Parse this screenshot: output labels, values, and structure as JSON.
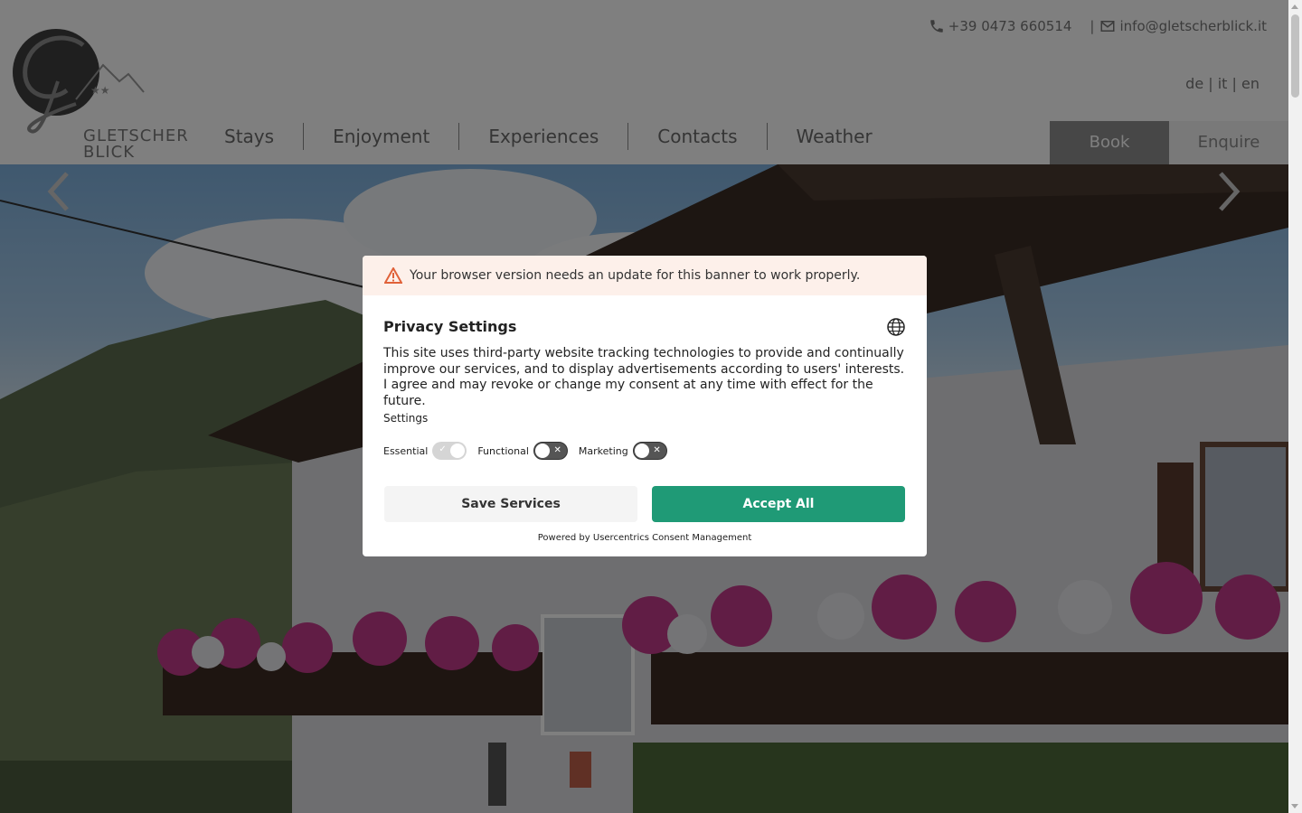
{
  "header": {
    "logo_text_line1": "GLETSCHER",
    "logo_text_line2": "BLICK",
    "phone": "+39 0473 660514",
    "separator": "|",
    "email": "info@gletscherblick.it",
    "languages": [
      "de",
      "it",
      "en"
    ],
    "lang_separator": " | ",
    "nav": [
      "Stays",
      "Enjoyment",
      "Experiences",
      "Contacts",
      "Weather"
    ],
    "book_label": "Book",
    "enquire_label": "Enquire"
  },
  "hero": {
    "prev_icon": "chevron-left-icon",
    "next_icon": "chevron-right-icon"
  },
  "consent": {
    "warning": "Your browser version needs an update for this banner to work properly.",
    "title": "Privacy Settings",
    "description": "This site uses third-party website tracking technologies to provide and continually improve our services, and to display advertisements according to users' interests. I agree and may revoke or change my consent at any time with effect for the future.",
    "settings_label": "Settings",
    "toggles": [
      {
        "label": "Essential",
        "state": "on"
      },
      {
        "label": "Functional",
        "state": "off"
      },
      {
        "label": "Marketing",
        "state": "off"
      }
    ],
    "save_label": "Save Services",
    "accept_label": "Accept All",
    "powered_by": "Powered by Usercentrics Consent Management"
  },
  "colors": {
    "accept": "#1f9a76",
    "warn_bg": "#fdf0ea",
    "warn_icon": "#e0623a",
    "book_bg": "#8f8f8f"
  }
}
